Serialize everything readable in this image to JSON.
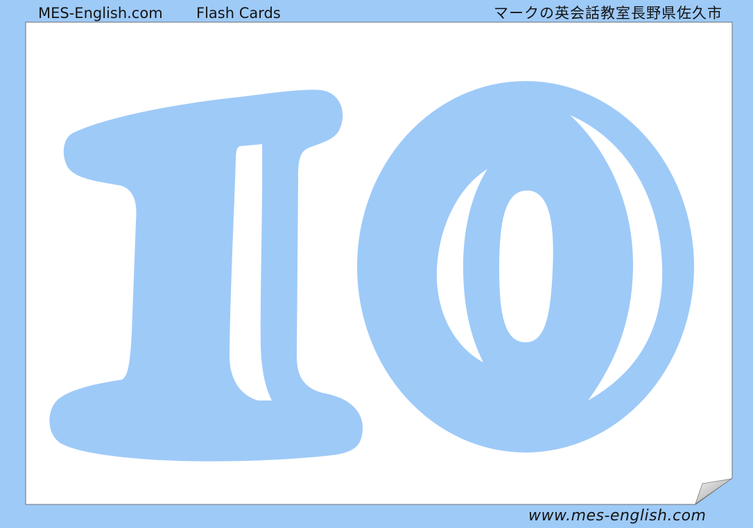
{
  "header": {
    "site": "MES-English.com",
    "product": "Flash Cards",
    "school": "マークの英会話教室長野県佐久市"
  },
  "card": {
    "numeral": "10"
  },
  "footer": {
    "url": "www.mes-english.com"
  },
  "icons": {
    "page_curl": "page-curl-icon"
  },
  "colors": {
    "frame": "#9ecaf8",
    "numeral": "#9ecaf8",
    "paper": "#ffffff",
    "ink": "#141414"
  }
}
